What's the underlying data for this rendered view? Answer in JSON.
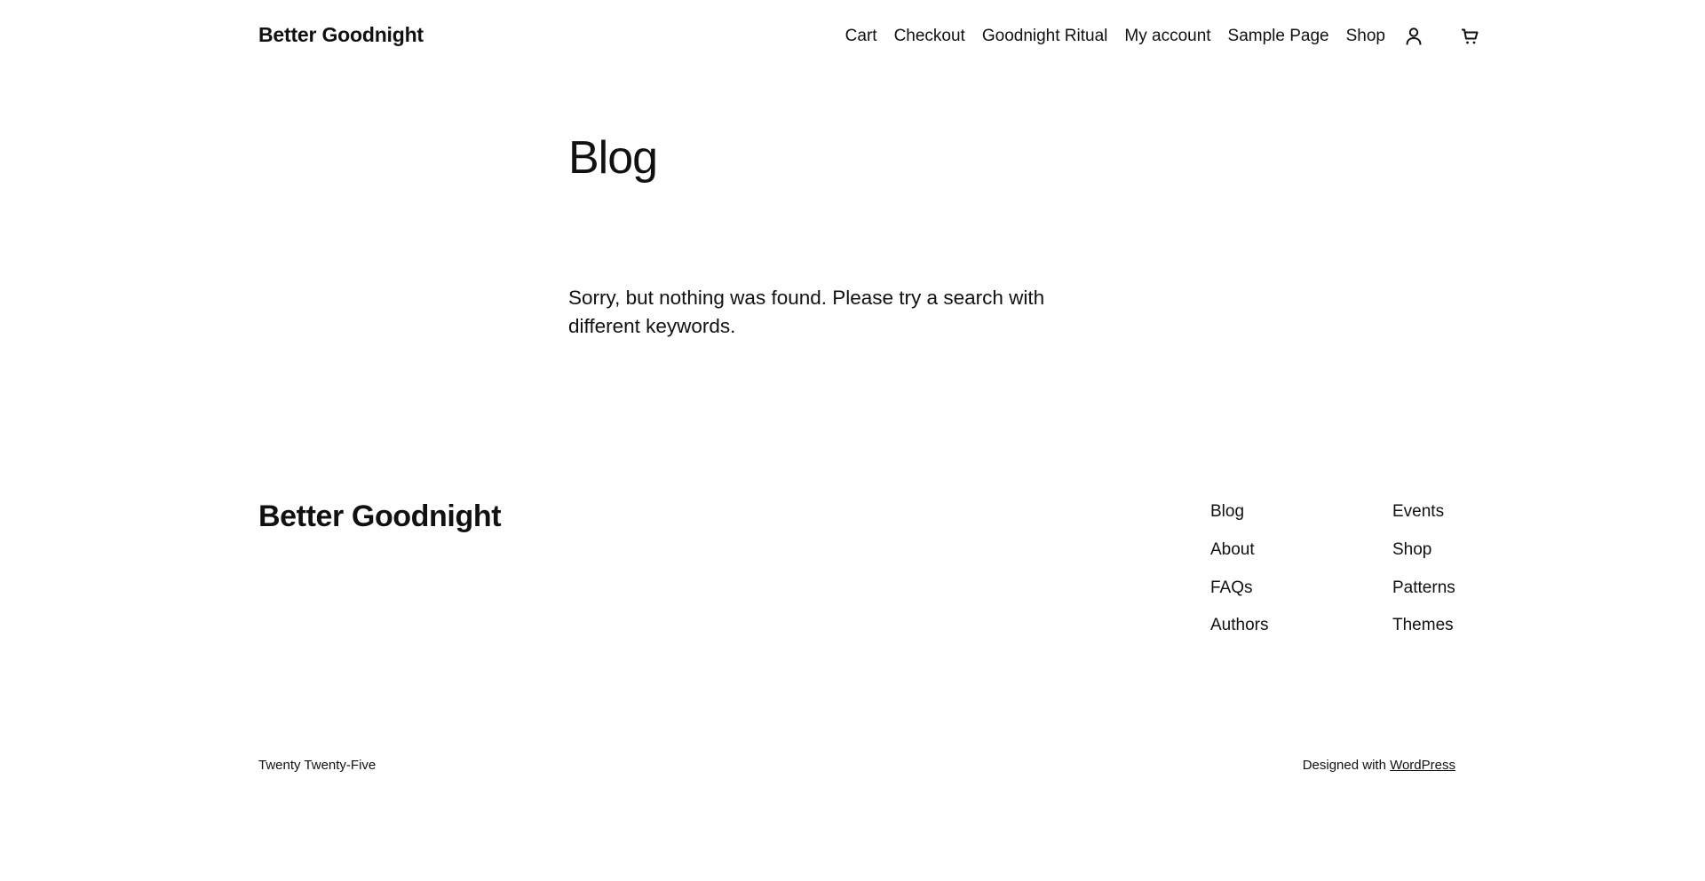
{
  "header": {
    "site_title": "Better Goodnight",
    "nav": [
      {
        "label": "Cart"
      },
      {
        "label": "Checkout"
      },
      {
        "label": "Goodnight Ritual"
      },
      {
        "label": "My account"
      },
      {
        "label": "Sample Page"
      },
      {
        "label": "Shop"
      }
    ],
    "icons": {
      "account": "account-icon",
      "cart": "cart-icon"
    }
  },
  "main": {
    "title": "Blog",
    "no_results": "Sorry, but nothing was found. Please try a search with different keywords."
  },
  "footer": {
    "site_title": "Better Goodnight",
    "col1": [
      {
        "label": "Blog"
      },
      {
        "label": "About"
      },
      {
        "label": "FAQs"
      },
      {
        "label": "Authors"
      }
    ],
    "col2": [
      {
        "label": "Events"
      },
      {
        "label": "Shop"
      },
      {
        "label": "Patterns"
      },
      {
        "label": "Themes"
      }
    ],
    "theme_name": "Twenty Twenty-Five",
    "credit_prefix": "Designed with ",
    "credit_link": "WordPress"
  }
}
